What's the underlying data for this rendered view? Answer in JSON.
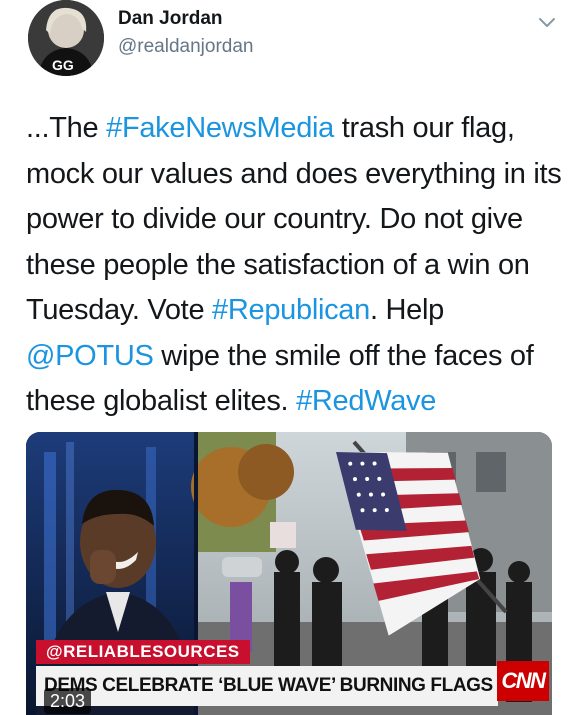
{
  "author": {
    "name": "Dan Jordan",
    "handle": "@realdanjordan",
    "avatar_icon": "profile-avatar"
  },
  "tweet": {
    "segments": [
      {
        "text": "...The ",
        "type": "text"
      },
      {
        "text": "#FakeNewsMedia",
        "type": "link"
      },
      {
        "text": " trash our flag, mock our values and does everything in its power to divide our country. Do not give these people the satisfaction of a win on Tuesday. Vote ",
        "type": "text"
      },
      {
        "text": "#Republican",
        "type": "link"
      },
      {
        "text": ". Help ",
        "type": "text"
      },
      {
        "text": "@POTUS",
        "type": "link"
      },
      {
        "text": " wipe the smile off the faces of these globalist elites. ",
        "type": "text"
      },
      {
        "text": "#RedWave",
        "type": "link"
      }
    ]
  },
  "media": {
    "source_tag": "@RELIABLESOURCES",
    "headline": "DEMS CELEBRATE ‘BLUE WAVE’ BURNING FLAGS ON ELECTION DAY",
    "network_logo": "CNN",
    "duration": "2:03"
  },
  "colors": {
    "link": "#1b95e0",
    "handle": "#657786",
    "chyron_red": "#c8102e",
    "cnn_red": "#cc0000"
  },
  "icons": {
    "menu": "chevron-down-icon"
  }
}
